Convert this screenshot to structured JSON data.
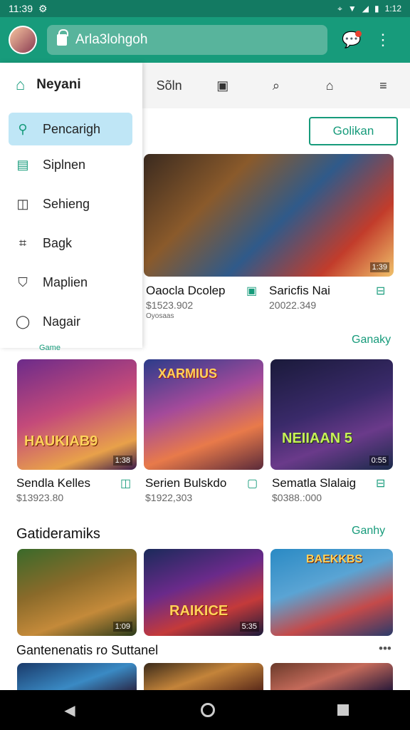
{
  "statusbar": {
    "time": "11:39",
    "right": "1:12"
  },
  "appbar": {
    "url": "Arla3lohgoh"
  },
  "drawer": {
    "header": "Neyani",
    "items": [
      {
        "label": "Pencarigh",
        "icon": "search-icon"
      },
      {
        "label": "Siplnen",
        "icon": "card-icon"
      },
      {
        "label": "Sehieng",
        "icon": "bag-icon"
      },
      {
        "label": "Bagk",
        "icon": "tag-icon"
      },
      {
        "label": "Maplien",
        "icon": "shield-icon"
      },
      {
        "label": "Nagair",
        "icon": "pin-icon"
      }
    ],
    "sub_label": "Game"
  },
  "tabs": [
    "Sõln",
    "",
    "",
    "",
    ""
  ],
  "collect_button": "Golikan",
  "featured": {
    "badge": "1:39",
    "left_title": "Oaocla Dcolep",
    "left_price": "$1523.902",
    "left_sub": "Oyosaas",
    "right_title": "Saricfis Nai",
    "right_price": "20022.349"
  },
  "section1": {
    "link": "Ganaky",
    "cards": [
      {
        "title": "Sendla Kelles",
        "price": "$13923.80",
        "badge": "1:38",
        "art": "HAUKIAB9"
      },
      {
        "title": "Serien Bulskdo",
        "price": "$1922,303",
        "badge": "",
        "art": "XARMIUS"
      },
      {
        "title": "Sematla Slalaig",
        "price": "$0388.:000",
        "badge": "0:55",
        "art": "NEIIAAN 5"
      }
    ]
  },
  "section2": {
    "title": "Gatideramiks",
    "link": "Ganhy",
    "cards": [
      {
        "badge": "1:09",
        "art": ""
      },
      {
        "badge": "5:35",
        "art": "RAIKICE"
      },
      {
        "badge": "",
        "art": "BAEKKBS"
      }
    ]
  },
  "section3": {
    "title": "Gantenenatis ro Suttanel",
    "more": "•••"
  }
}
